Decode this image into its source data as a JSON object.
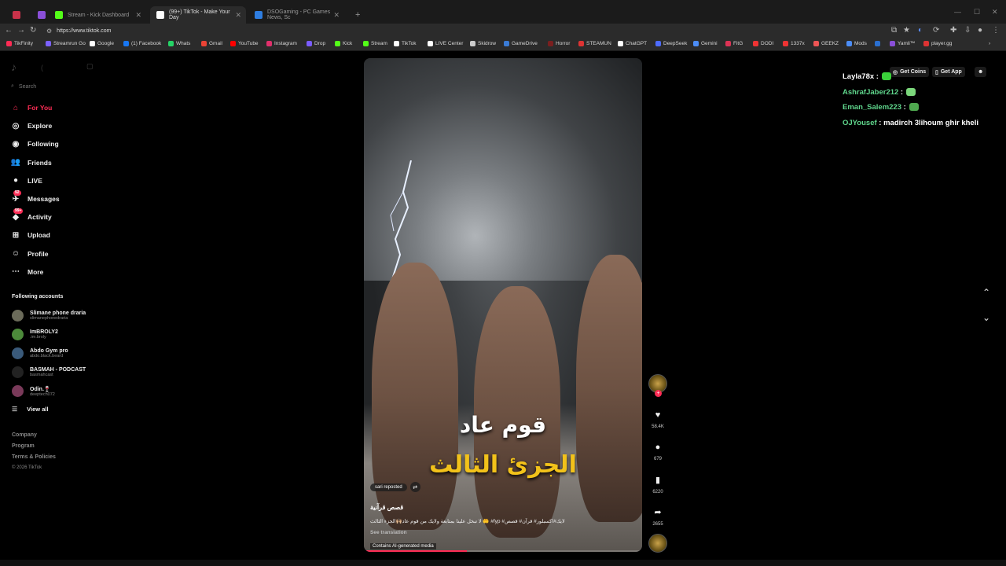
{
  "browser": {
    "tabs": [
      {
        "label": "",
        "color": "#c8324a"
      },
      {
        "label": "",
        "color": "#8a4fd8"
      },
      {
        "label": "Stream - Kick Dashboard",
        "color": "#53fc18"
      },
      {
        "label": "(99+) TikTok - Make Your Day",
        "color": "#ffffff"
      },
      {
        "label": "DSOGaming - PC Games News, Sc",
        "color": "#2e7de0"
      }
    ],
    "new_tab": "+",
    "url": "https://www.tiktok.com",
    "bookmarks": [
      {
        "label": "TikFinity",
        "color": "#fe2c55"
      },
      {
        "label": "Streamrun Go",
        "color": "#7b61ff"
      },
      {
        "label": "Google",
        "color": "#ffffff"
      },
      {
        "label": "(1) Facebook",
        "color": "#1877f2"
      },
      {
        "label": "Whats",
        "color": "#25d366"
      },
      {
        "label": "Gmail",
        "color": "#ea4335"
      },
      {
        "label": "YouTube",
        "color": "#ff0000"
      },
      {
        "label": "Instagram",
        "color": "#e1306c"
      },
      {
        "label": "Drop",
        "color": "#7a5cff"
      },
      {
        "label": "Kick",
        "color": "#53fc18"
      },
      {
        "label": "Stream",
        "color": "#53fc18"
      },
      {
        "label": "TikTok",
        "color": "#ffffff"
      },
      {
        "label": "LIVE Center",
        "color": "#ffffff"
      },
      {
        "label": "Skidrow",
        "color": "#cccccc"
      },
      {
        "label": "GameDrive",
        "color": "#3a7bd5"
      },
      {
        "label": "Horror",
        "color": "#7a1f1f"
      },
      {
        "label": "STEAMUN",
        "color": "#d33"
      },
      {
        "label": "ChatGPT",
        "color": "#ffffff"
      },
      {
        "label": "DeepSeek",
        "color": "#4d6bfe"
      },
      {
        "label": "Gemini",
        "color": "#4c8df6"
      },
      {
        "label": "FitG",
        "color": "#d35"
      },
      {
        "label": "DODI",
        "color": "#e33"
      },
      {
        "label": "1337x",
        "color": "#e33"
      },
      {
        "label": "GEEKZ",
        "color": "#e55"
      },
      {
        "label": "Mods",
        "color": "#4c8df6"
      },
      {
        "label": "",
        "color": "#2a6fd0"
      },
      {
        "label": "Yamli™",
        "color": "#8a4fd8"
      },
      {
        "label": "player.gg",
        "color": "#d33"
      }
    ]
  },
  "tiktok": {
    "search_placeholder": "Search",
    "nav": [
      {
        "label": "For You",
        "icon": "home-icon",
        "glyph": "⌂"
      },
      {
        "label": "Explore",
        "icon": "compass-icon",
        "glyph": "◎"
      },
      {
        "label": "Following",
        "icon": "following-icon",
        "glyph": "◉"
      },
      {
        "label": "Friends",
        "icon": "friends-icon",
        "glyph": "👥"
      },
      {
        "label": "LIVE",
        "icon": "live-icon",
        "glyph": "●"
      },
      {
        "label": "Messages",
        "icon": "messages-icon",
        "glyph": "✈",
        "badge": "92"
      },
      {
        "label": "Activity",
        "icon": "activity-icon",
        "glyph": "◆",
        "badge": "99+"
      },
      {
        "label": "Upload",
        "icon": "upload-icon",
        "glyph": "⊞"
      },
      {
        "label": "Profile",
        "icon": "profile-icon",
        "glyph": "☺"
      },
      {
        "label": "More",
        "icon": "more-icon",
        "glyph": "⋯"
      }
    ],
    "following_title": "Following accounts",
    "following": [
      {
        "name": "Slimane phone draria",
        "handle": "slimanephonedraria",
        "color": "#6b6b5a"
      },
      {
        "name": "ImBROLY2",
        "handle": ".im.broly",
        "color": "#4c8a3a"
      },
      {
        "name": "Abdo Gym pro",
        "handle": "abdo.black.beard",
        "color": "#3a5a7a"
      },
      {
        "name": "BASMAH - PODCAST",
        "handle": "basmahcast",
        "color": "#222222"
      },
      {
        "name": "Odin.🍷",
        "handle": "deeptech072",
        "color": "#7a3a5a"
      }
    ],
    "view_all": "View all",
    "footer": [
      "Company",
      "Program",
      "Terms & Policies"
    ],
    "copyright": "© 2026 TikTok",
    "get_coins": "Get Coins",
    "get_app": "Get App",
    "video": {
      "title_line1": "قوم عاد",
      "title_line2": "الجزئ الثالث",
      "repost_label": "sari reposted",
      "author": "قصص قرآنية",
      "caption": "لايك#اكسبلور# قرآن# قصص# fyp# 🤲 لا تبخل علينا بمتابعة ولايك من قوم عاد🙌🏼الجزء الثالث",
      "see_translation": "See translation",
      "ai_label": "Contains AI-generated media",
      "progress": 0.37
    },
    "actions": {
      "likes": "58.4K",
      "comments": "679",
      "saves": "6220",
      "shares": "2655"
    }
  },
  "chat": [
    {
      "user": "Layla78x",
      "sep": " :",
      "msg": "",
      "user_color": "#ffffff",
      "emote": "#3ad13a"
    },
    {
      "user": "AshrafJaber212",
      "sep": " :",
      "msg": "",
      "user_color": "#5fd68c",
      "emote": "#7bd67b"
    },
    {
      "user": "Eman_Salem223",
      "sep": " :",
      "msg": "",
      "user_color": "#5fd68c",
      "emote": "#4fa84f"
    },
    {
      "user": "OJYousef",
      "sep": " :",
      "msg": " madirch 3lihoum ghir kheli",
      "user_color": "#5fd68c",
      "emote": ""
    }
  ]
}
